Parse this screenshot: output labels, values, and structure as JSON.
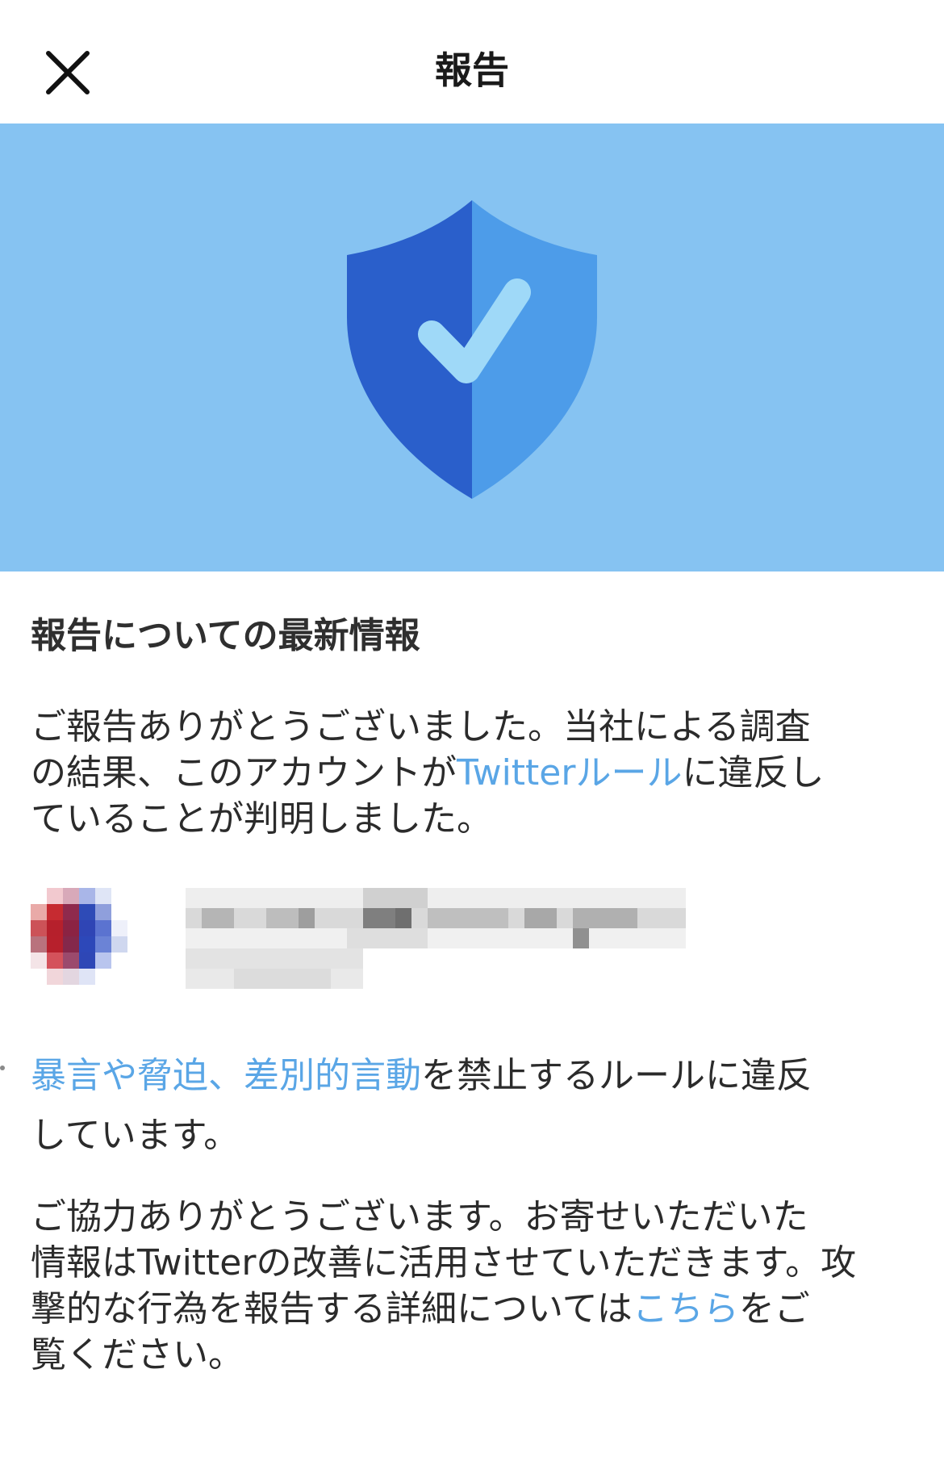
{
  "header": {
    "title": "報告",
    "close_icon": "close-icon"
  },
  "hero": {
    "background": "#86c3f2",
    "icon": "shield-check-icon"
  },
  "content": {
    "heading": "報告についての最新情報",
    "p1": {
      "line1": "ご報告ありがとうございました。当社による調査",
      "line2_a": "の結果、このアカウントが",
      "line2_link": "Twitterルール",
      "line2_b": "に違反し",
      "line3": "ていることが判明しました。"
    },
    "violation": {
      "link": "暴言や脅迫、差別的言動",
      "line1_rest": "を禁止するルールに違反",
      "line2": "しています。"
    },
    "p3": {
      "line1": "ご協力ありがとうございます。お寄せいただいた",
      "line2": "情報はTwitterの改善に活用させていただきます。攻",
      "line3_a": "撃的な行為を報告する詳細については",
      "line3_link": "こちら",
      "line3_b": "をご",
      "line4": "覧ください。"
    }
  },
  "colors": {
    "link": "#5aa6e6",
    "shield_dark": "#2a5fcb",
    "shield_light": "#4d9ce9",
    "check": "#9fd9f8"
  }
}
